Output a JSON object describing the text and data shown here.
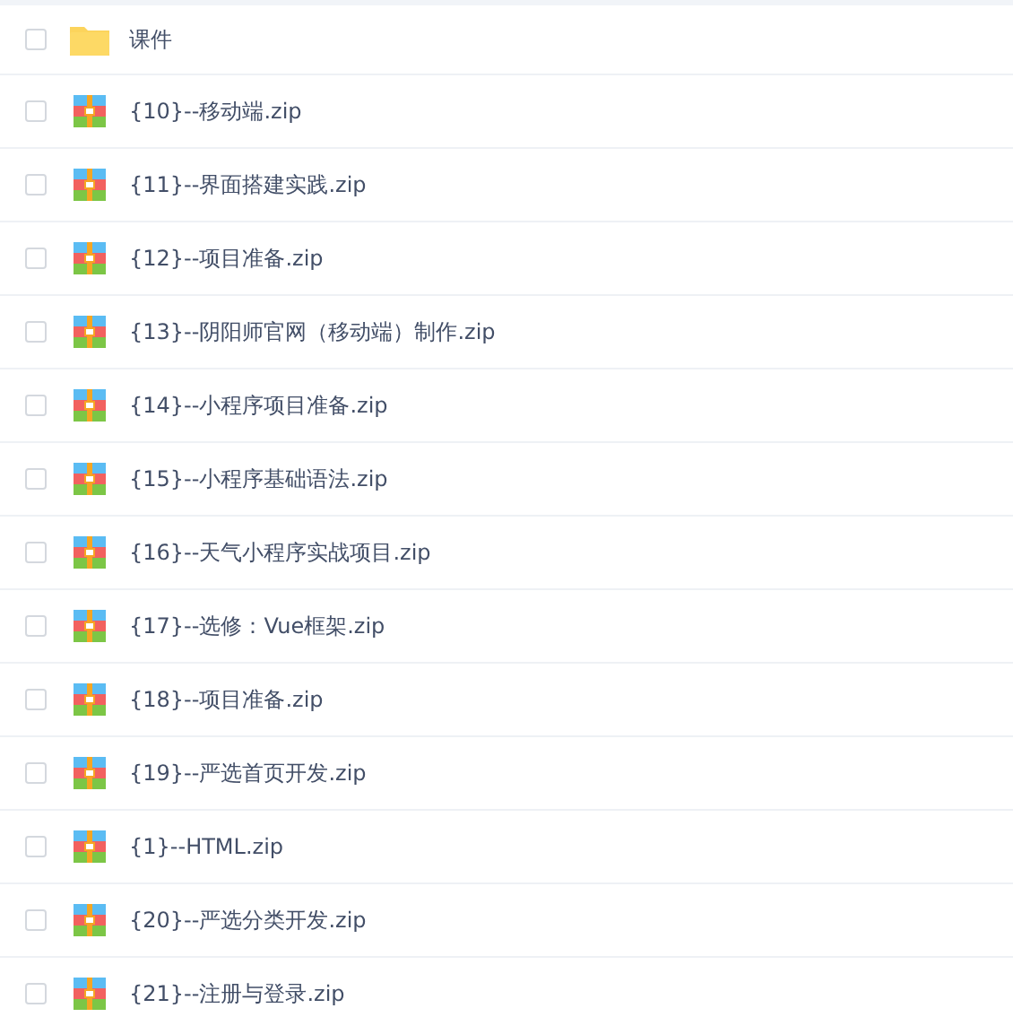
{
  "files": [
    {
      "name": "课件",
      "kind": "folder",
      "checked": false
    },
    {
      "name": "{10}--移动端.zip",
      "kind": "zip",
      "checked": false
    },
    {
      "name": "{11}--界面搭建实践.zip",
      "kind": "zip",
      "checked": false
    },
    {
      "name": "{12}--项目准备.zip",
      "kind": "zip",
      "checked": false
    },
    {
      "name": "{13}--阴阳师官网（移动端）制作.zip",
      "kind": "zip",
      "checked": false
    },
    {
      "name": "{14}--小程序项目准备.zip",
      "kind": "zip",
      "checked": false
    },
    {
      "name": "{15}--小程序基础语法.zip",
      "kind": "zip",
      "checked": false
    },
    {
      "name": "{16}--天气小程序实战项目.zip",
      "kind": "zip",
      "checked": false
    },
    {
      "name": "{17}--选修：Vue框架.zip",
      "kind": "zip",
      "checked": false
    },
    {
      "name": "{18}--项目准备.zip",
      "kind": "zip",
      "checked": false
    },
    {
      "name": "{19}--严选首页开发.zip",
      "kind": "zip",
      "checked": false
    },
    {
      "name": "{1}--HTML.zip",
      "kind": "zip",
      "checked": false
    },
    {
      "name": "{20}--严选分类开发.zip",
      "kind": "zip",
      "checked": false
    },
    {
      "name": "{21}--注册与登录.zip",
      "kind": "zip",
      "checked": false
    }
  ]
}
